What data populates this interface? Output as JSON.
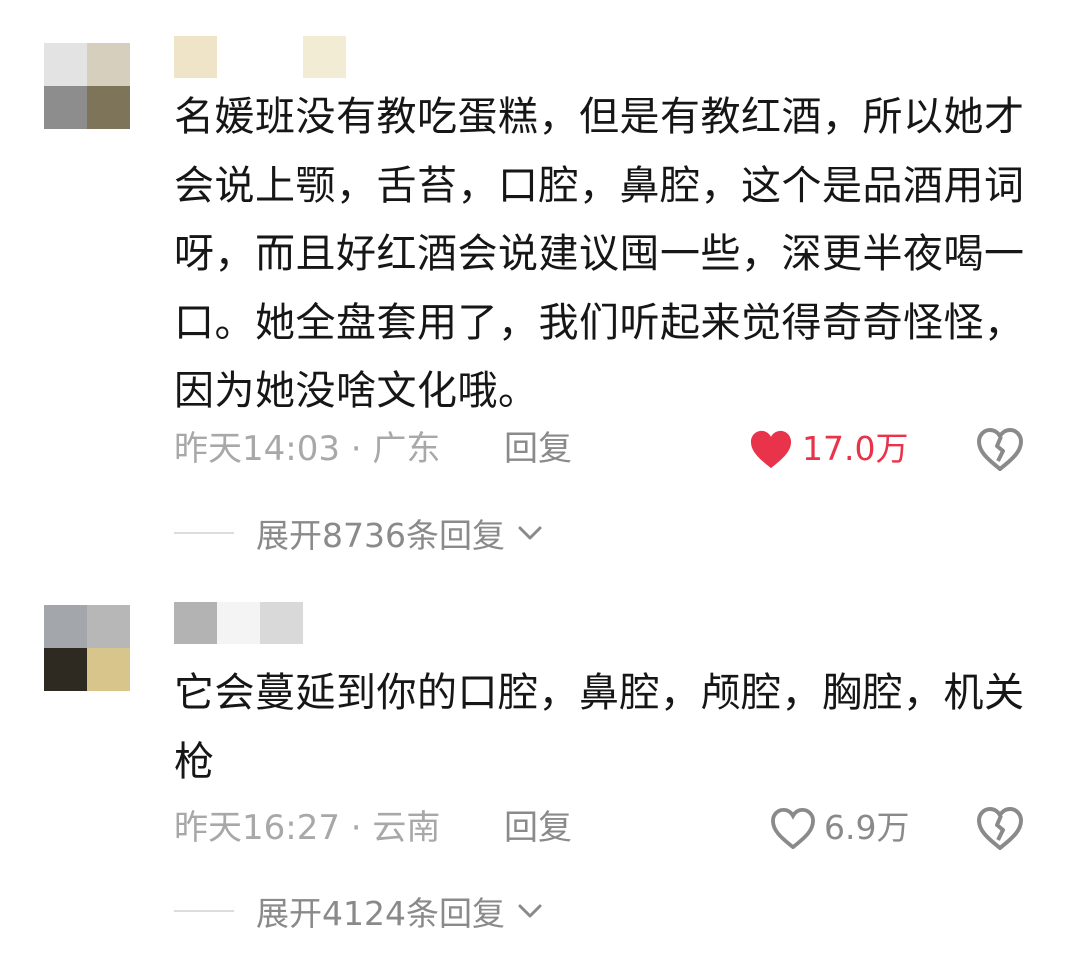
{
  "comments": [
    {
      "avatar_tiles": [
        "#e3e3e3",
        "#d6cfbd",
        "#8d8d8d",
        "#7d7459"
      ],
      "username_tiles": [
        "#efe4c7",
        "#ffffff",
        "#ffffff",
        "#f3ecd4"
      ],
      "text": "名媛班没有教吃蛋糕，但是有教红酒，所以她才会说上颚，舌苔，口腔，鼻腔，这个是品酒用词呀，而且好红酒会说建议囤一些，深更半夜喝一口。她全盘套用了，我们听起来觉得奇奇怪怪，因为她没啥文化哦。",
      "time": "昨天14:03 · 广东",
      "reply_label": "回复",
      "like_count": "17.0万",
      "liked": true,
      "expand_label": "展开8736条回复"
    },
    {
      "avatar_tiles": [
        "#a3a7ab",
        "#b7b7b7",
        "#2e2a22",
        "#d8c58c"
      ],
      "username_tiles": [
        "#b3b3b3",
        "#f4f4f4",
        "#d9d9d9"
      ],
      "text": "它会蔓延到你的口腔，鼻腔，颅腔，胸腔，机关枪",
      "time": "昨天16:27 · 云南",
      "reply_label": "回复",
      "like_count": "6.9万",
      "liked": false,
      "expand_label": "展开4124条回复"
    }
  ],
  "colors": {
    "liked_heart": "#e8334a",
    "muted_text": "#a8a8a8",
    "body_text": "#161616"
  },
  "icons": {
    "like": "heart-icon",
    "dislike": "broken-heart-icon",
    "expand": "chevron-down-icon"
  }
}
